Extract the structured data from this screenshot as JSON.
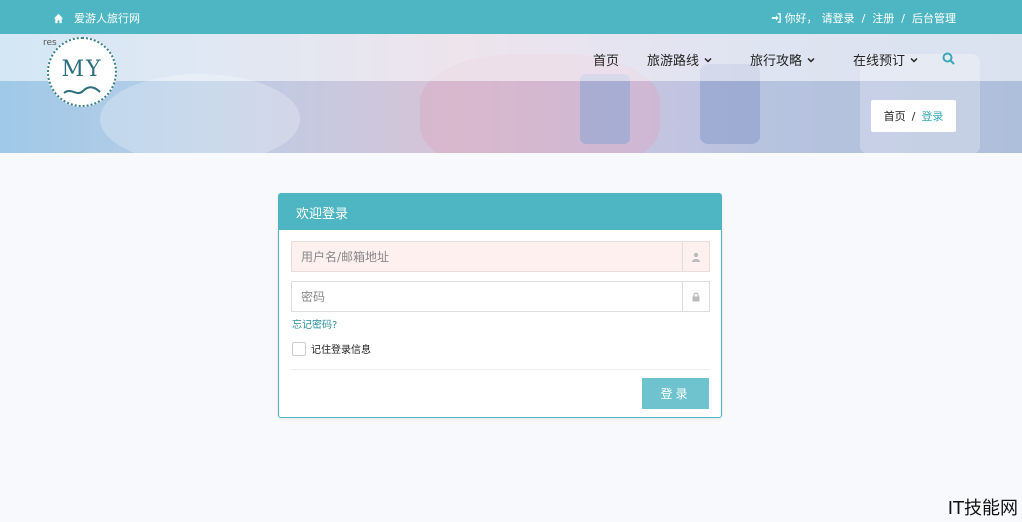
{
  "topbar": {
    "site_name": "爱游人旅行网",
    "greeting": "你好，",
    "login_link": "请登录",
    "sep1": "/",
    "register_link": "注册",
    "sep2": "/",
    "admin_link": "后台管理"
  },
  "logo": {
    "mark": "res",
    "text": "MY"
  },
  "nav": {
    "items": [
      {
        "label": "首页"
      },
      {
        "label": "旅游路线"
      },
      {
        "label": "旅行攻略"
      },
      {
        "label": "在线预订"
      }
    ]
  },
  "breadcrumb": {
    "home": "首页",
    "sep": "/",
    "current": "登录"
  },
  "login": {
    "title": "欢迎登录",
    "username_placeholder": "用户名/邮箱地址",
    "password_placeholder": "密码",
    "forgot": "忘记密码?",
    "remember": "记住登录信息",
    "submit": "登录"
  },
  "watermark": "IT技能网",
  "colors": {
    "accent": "#4db6c2",
    "button": "#6ec3cf",
    "link": "#2b8f9a"
  }
}
